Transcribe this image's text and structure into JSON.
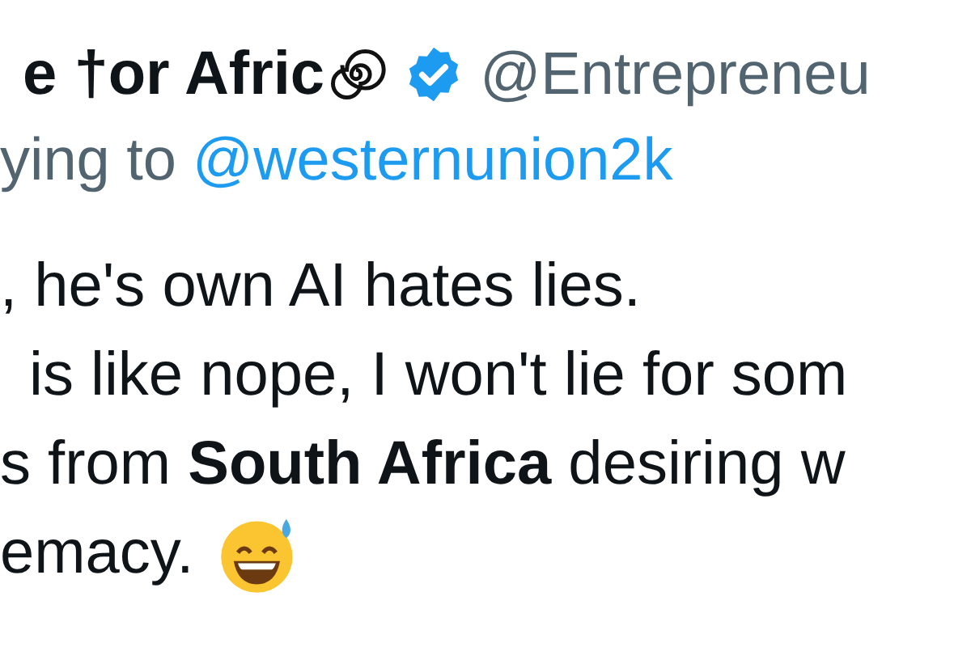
{
  "author": {
    "name": "e †or Afric",
    "verified": true,
    "handle": "@Entrepreneu"
  },
  "reply": {
    "prefix": "ying to",
    "mention": "@westernunion2k"
  },
  "body": {
    "lines": [
      ", he's own AI hates lies.",
      "is like nope, I won't lie for som",
      "s from **South Africa** desiring w",
      "emacy."
    ]
  }
}
